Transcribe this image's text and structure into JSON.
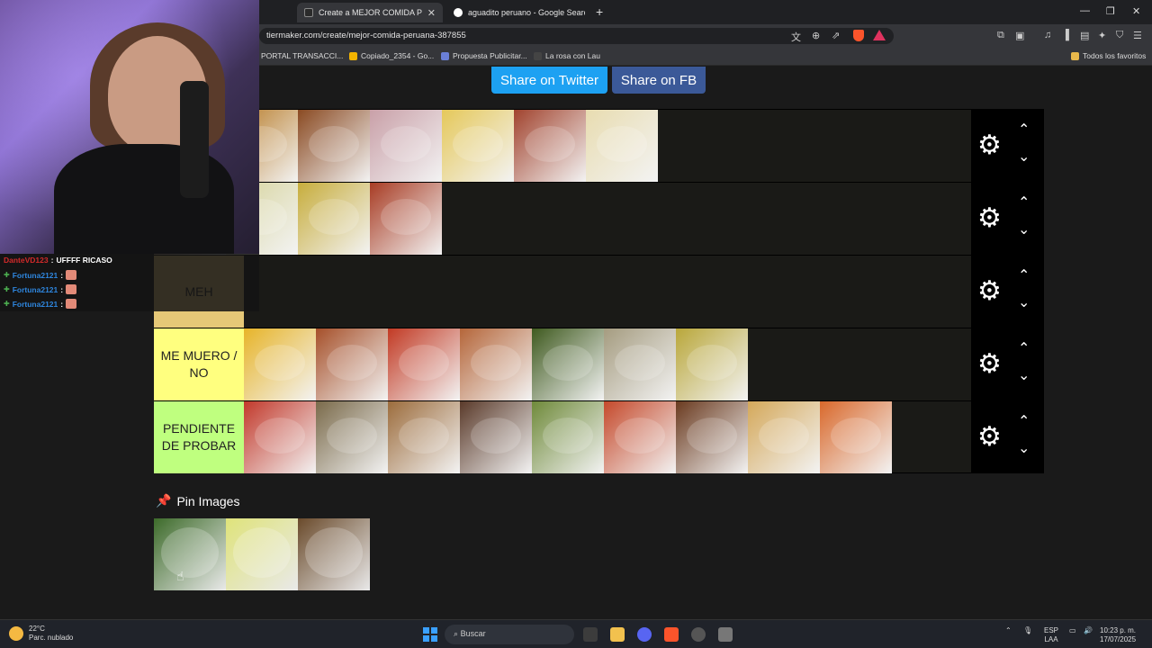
{
  "browser": {
    "tabs": [
      {
        "title": "Create a MEJOR COMIDA PERUANA",
        "active": true
      },
      {
        "title": "aguadito peruano - Google Search",
        "active": false
      }
    ],
    "url": "tiermaker.com/create/mejor-comida-peruana-387855",
    "bookmarks": [
      "PORTAL TRANSACCI...",
      "Copiado_2354 - Go...",
      "Propuesta Publicitar...",
      "La rosa con Lau"
    ],
    "all_bookmarks": "Todos los favoritos",
    "shield_count": "7"
  },
  "page": {
    "share_twitter": "Share on Twitter",
    "share_fb": "Share on FB",
    "tiers": [
      {
        "label": "",
        "color": "#1a1a17",
        "items": [
          "#7a3b2b",
          "#b5761f",
          "#8a4a22",
          "#c9a0a8",
          "#e5c85a",
          "#a1432e",
          "#e8dcb0"
        ]
      },
      {
        "label": "",
        "color": "#1a1a17",
        "items": [
          "#8b5a2b",
          "#d6d39a",
          "#c7ad3c",
          "#a83c24"
        ]
      },
      {
        "label": "MEH",
        "color": "#e6c877",
        "items": []
      },
      {
        "label": "ME MUERO / NO",
        "color": "#ffff7f",
        "items": [
          "#e7b429",
          "#a6502a",
          "#c23a24",
          "#b5663a",
          "#3f5a1f",
          "#a59c80",
          "#b9a73a"
        ]
      },
      {
        "label": "PENDIENTE DE PROBAR",
        "color": "#bfff7f",
        "items": [
          "#c2392b",
          "#7a6a4a",
          "#9c6c3c",
          "#5a3a2a",
          "#6f8a3a",
          "#c5492b",
          "#6a3a1f",
          "#d4a85a",
          "#d9682b"
        ]
      }
    ],
    "pin_title": "Pin Images",
    "pins": [
      "#3d6b2a",
      "#dfe37a",
      "#6a4a2b"
    ]
  },
  "stream": {
    "chat": [
      {
        "user": "DanteVD123",
        "user_color": "red",
        "message": "UFFFF RICASO",
        "mod": false
      },
      {
        "user": "Fortuna2121",
        "user_color": "blue",
        "message": "",
        "mod": true
      },
      {
        "user": "Fortuna2121",
        "user_color": "blue",
        "message": "",
        "mod": true
      },
      {
        "user": "Fortuna2121",
        "user_color": "blue",
        "message": "",
        "mod": true
      }
    ]
  },
  "taskbar": {
    "temperature": "22°C",
    "weather": "Parc. nublado",
    "search_placeholder": "Buscar",
    "lang": "ESP",
    "lang2": "LAA",
    "time": "10:23 p. m.",
    "date": "17/07/2025"
  }
}
